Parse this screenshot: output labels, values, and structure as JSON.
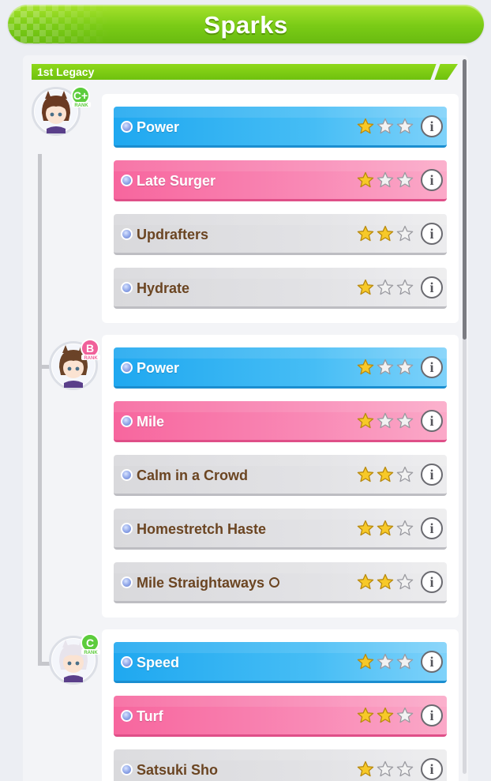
{
  "header": {
    "title": "Sparks"
  },
  "legacy": {
    "label": "1st Legacy"
  },
  "colors": {
    "blue": "#2aaef2",
    "pink": "#f87aa9",
    "white": "#dfdfe2",
    "green": "#7acb16",
    "brown": "#6b4522"
  },
  "parents": [
    {
      "rank": "C+",
      "rank_sub": "RANK",
      "rank_color": "#5ccc3c",
      "sparks": [
        {
          "name": "Power",
          "type": "blue",
          "stars": 1,
          "marked": false
        },
        {
          "name": "Late Surger",
          "type": "pink",
          "stars": 1,
          "marked": false
        },
        {
          "name": "Updrafters",
          "type": "white",
          "stars": 2,
          "marked": false
        },
        {
          "name": "Hydrate",
          "type": "white",
          "stars": 1,
          "marked": false
        }
      ]
    },
    {
      "rank": "B",
      "rank_sub": "RANK",
      "rank_color": "#f0609a",
      "sparks": [
        {
          "name": "Power",
          "type": "blue",
          "stars": 1,
          "marked": false
        },
        {
          "name": "Mile",
          "type": "pink",
          "stars": 1,
          "marked": false
        },
        {
          "name": "Calm in a Crowd",
          "type": "white",
          "stars": 2,
          "marked": false
        },
        {
          "name": "Homestretch Haste",
          "type": "white",
          "stars": 2,
          "marked": false
        },
        {
          "name": "Mile Straightaways",
          "type": "white",
          "stars": 2,
          "marked": true
        }
      ]
    },
    {
      "rank": "C",
      "rank_sub": "RANK",
      "rank_color": "#5ccc3c",
      "sparks": [
        {
          "name": "Speed",
          "type": "blue",
          "stars": 1,
          "marked": false
        },
        {
          "name": "Turf",
          "type": "pink",
          "stars": 2,
          "marked": false
        },
        {
          "name": "Satsuki Sho",
          "type": "white",
          "stars": 1,
          "marked": false
        }
      ]
    }
  ],
  "icons": {
    "bullet": "blue-orb-icon",
    "star": "star-icon",
    "info": "info-icon"
  }
}
